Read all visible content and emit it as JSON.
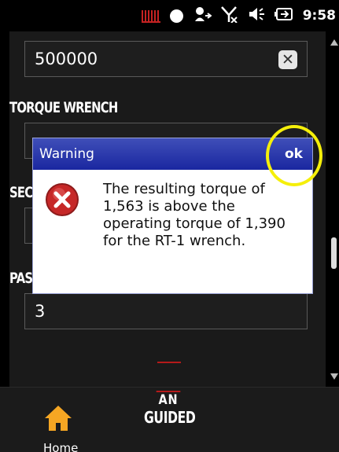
{
  "status_bar": {
    "time": "9:58",
    "icons": [
      "signal-strength-icon",
      "circle-icon",
      "sync-icon",
      "no-signal-icon",
      "volume-icon",
      "battery-icon"
    ]
  },
  "form": {
    "field1_value": "500000",
    "torque_label": "TORQUE WRENCH",
    "torque_value": "",
    "section_label": "SEC",
    "pass_label": "PAS",
    "pass_value": "3"
  },
  "dialog": {
    "title": "Warning",
    "ok_label": "ok",
    "message": "The resulting torque of 1,563 is above the operating torque of 1,390 for the RT-1 wrench."
  },
  "bottom_nav": {
    "home_label": "Home",
    "guided_top": "AN",
    "guided_label": "GUIDED"
  },
  "colors": {
    "dialog_header": "#2a37ad",
    "highlight": "#f5ef0a",
    "error_red": "#c62828"
  }
}
